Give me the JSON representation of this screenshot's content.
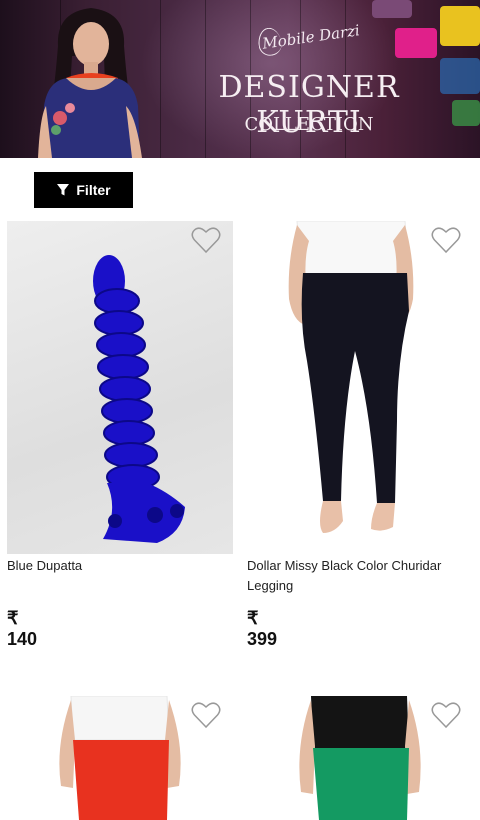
{
  "banner": {
    "brand": "Mobile Darzi",
    "title": "DESIGNER KURTI",
    "subtitle": "COLLECTION"
  },
  "filter": {
    "label": "Filter",
    "icon": "filter-icon"
  },
  "products": [
    {
      "name": "Blue Dupatta",
      "price": "₹ 140",
      "color": "#1a10c8"
    },
    {
      "name": "Dollar Missy Black Color Churidar Legging",
      "price": "₹ 399",
      "color": "#141420"
    },
    {
      "name": "",
      "price": "",
      "color": "#e8321f"
    },
    {
      "name": "",
      "price": "",
      "color": "#149a62"
    }
  ]
}
